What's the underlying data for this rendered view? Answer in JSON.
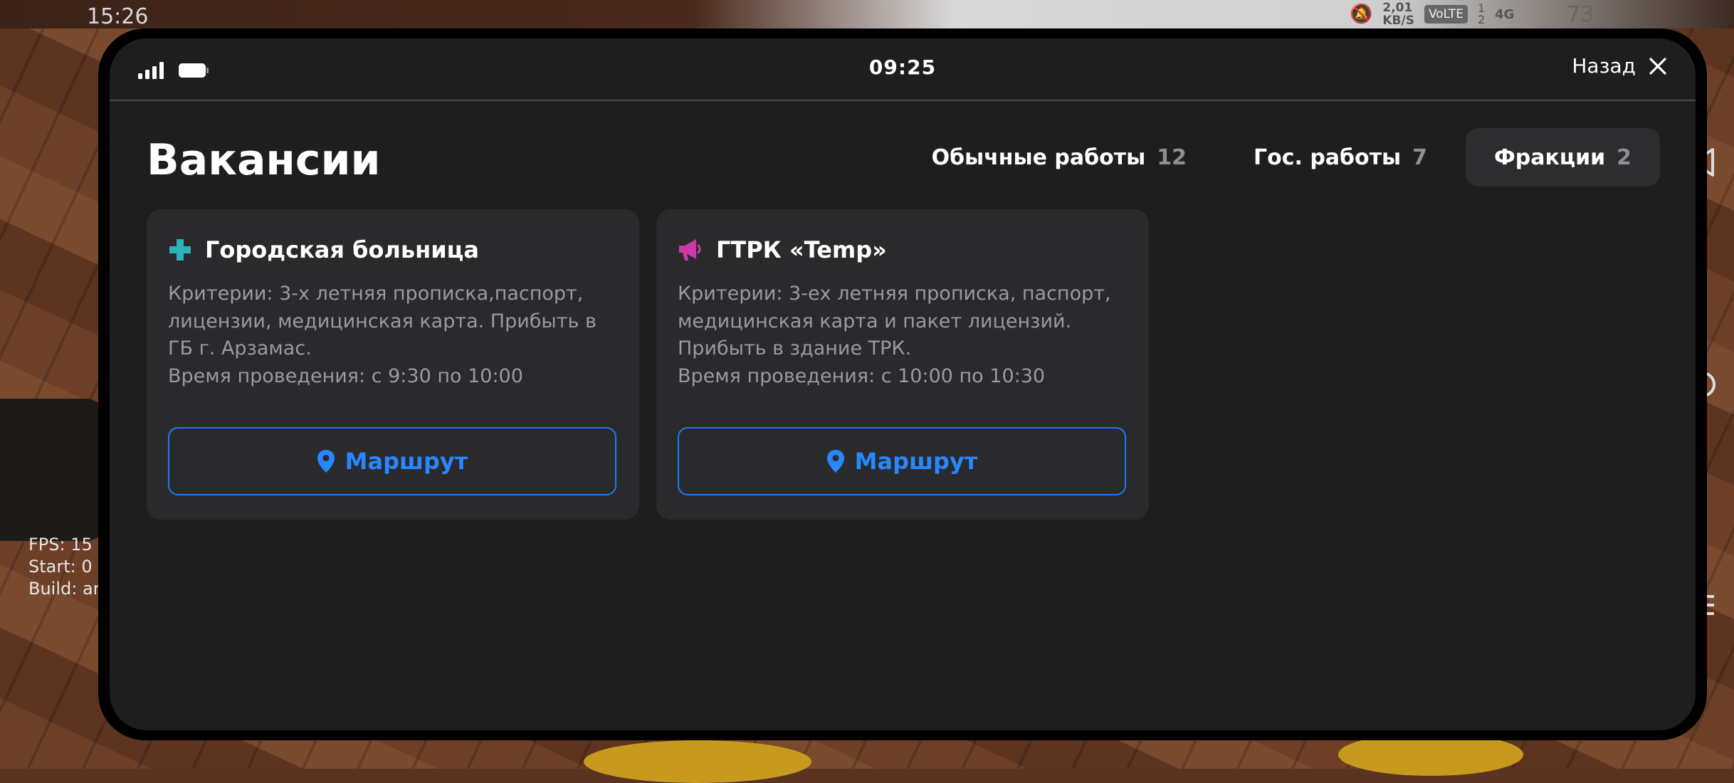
{
  "game_overlay": {
    "clock": "15:26",
    "net_speed": "2,01",
    "net_unit": "KB/S",
    "volte": "VoLTE",
    "sim_numbers": "1 2",
    "network": "4G",
    "battery_pct": "73",
    "debug_lines": [
      "FPS: 15",
      "Start: 0",
      "Build: ar"
    ]
  },
  "phone": {
    "status_time": "09:25",
    "back_label": "Назад"
  },
  "page": {
    "title": "Вакансии"
  },
  "tabs": [
    {
      "label": "Обычные работы",
      "count": "12",
      "active": false
    },
    {
      "label": "Гос. работы",
      "count": "7",
      "active": false
    },
    {
      "label": "Фракции",
      "count": "2",
      "active": true
    }
  ],
  "cards": [
    {
      "icon": "medical-cross-icon",
      "icon_color": "#2ab3b8",
      "title": "Городская больница",
      "criteria": "Критерии: 3-х летняя прописка,паспорт, лицензии, медицинская карта. Прибыть в ГБ г. Арзамас.",
      "time": "Время проведения: с 9:30 по 10:00",
      "button": "Маршрут"
    },
    {
      "icon": "megaphone-icon",
      "icon_color": "#c93aa7",
      "title": "ГТРК «Temp»",
      "criteria": "Критерии: 3-ех летняя прописка, паспорт, медицинская карта и пакет лицензий. Прибыть в здание ТРК.",
      "time": "Время проведения: с 10:00 по 10:30",
      "button": "Маршрут"
    }
  ],
  "colors": {
    "accent_blue": "#2787ff",
    "panel_bg": "#1e1e1f",
    "card_bg": "#2a2a2d"
  }
}
